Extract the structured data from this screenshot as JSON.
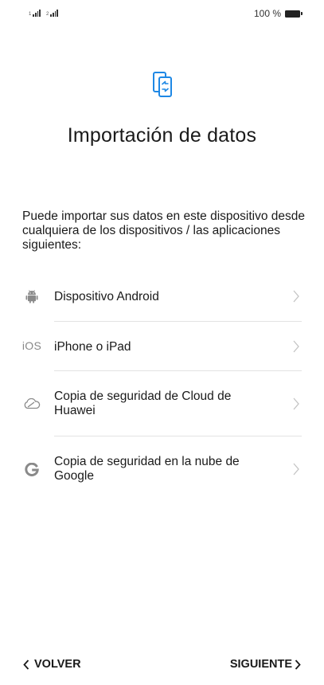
{
  "status_bar": {
    "signal_1_label": "1",
    "signal_2_label": "2",
    "battery_text": "100 %"
  },
  "header": {
    "icon": "phone-transfer-icon",
    "title": "Importación de datos",
    "accent_color": "#1e88e5"
  },
  "description": "Puede importar sus datos en este dispositivo desde cualquiera de los dispositivos / las aplicaciones siguientes:",
  "options": [
    {
      "icon": "android-icon",
      "label": "Dispositivo Android"
    },
    {
      "icon": "ios-icon",
      "icon_text": "iOS",
      "label": "iPhone o iPad"
    },
    {
      "icon": "cloud-icon",
      "label": "Copia de seguridad de Cloud de Huawei"
    },
    {
      "icon": "google-icon",
      "label": "Copia de seguridad en la nube de Google"
    }
  ],
  "footer": {
    "back_label": "VOLVER",
    "next_label": "SIGUIENTE"
  }
}
